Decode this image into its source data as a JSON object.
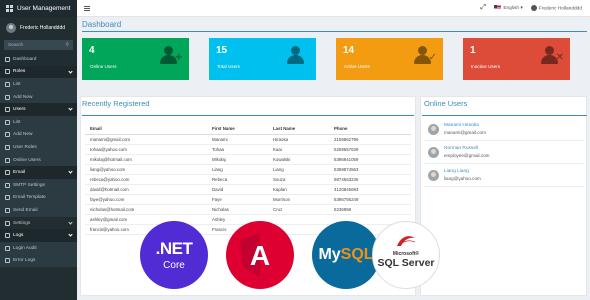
{
  "app": {
    "title": "User Management"
  },
  "sidebar": {
    "user_name": "Frederic Hollandddd",
    "search_placeholder": "Search",
    "items": [
      {
        "label": "Dashboard",
        "type": "item"
      },
      {
        "label": "Roles",
        "type": "header"
      },
      {
        "label": "List",
        "type": "sub"
      },
      {
        "label": "Add New",
        "type": "sub"
      },
      {
        "label": "Users",
        "type": "header"
      },
      {
        "label": "List",
        "type": "sub"
      },
      {
        "label": "Add New",
        "type": "sub"
      },
      {
        "label": "User Roles",
        "type": "sub"
      },
      {
        "label": "Online Users",
        "type": "sub"
      },
      {
        "label": "Email",
        "type": "header"
      },
      {
        "label": "SMTP Settings",
        "type": "sub"
      },
      {
        "label": "Email Template",
        "type": "sub"
      },
      {
        "label": "Send Email",
        "type": "sub"
      },
      {
        "label": "Settings",
        "type": "item"
      },
      {
        "label": "Logs",
        "type": "header"
      },
      {
        "label": "Login Audit",
        "type": "sub"
      },
      {
        "label": "Error Logs",
        "type": "sub"
      }
    ]
  },
  "topbar": {
    "language": "English",
    "user_name": "Frederic Hollandddd"
  },
  "page": {
    "title": "Dashboard"
  },
  "stats": [
    {
      "value": "4",
      "label": "Online Users",
      "color": "#00a65a",
      "icon": "user-plus-icon"
    },
    {
      "value": "15",
      "label": "Total Users",
      "color": "#00c0ef",
      "icon": "users-icon"
    },
    {
      "value": "14",
      "label": "Active Users",
      "color": "#f39c12",
      "icon": "user-check-icon"
    },
    {
      "value": "1",
      "label": "Inactive Users",
      "color": "#dd4b39",
      "icon": "user-times-icon"
    }
  ],
  "recent": {
    "title": "Recently Registered",
    "columns": [
      "Email",
      "First Name",
      "Last Name",
      "Phone"
    ],
    "rows": [
      [
        "manami@gmail.com",
        "Manami",
        "Hiraoka",
        "2159862796"
      ],
      [
        "tohaa@yahoo.com",
        "Tohaa",
        "Kaai",
        "5259657639"
      ],
      [
        "mikolaj@hotmail.com",
        "Mikołaj",
        "Kowalski",
        "6396941059"
      ],
      [
        "liang@yahoo.com",
        "Liang",
        "Liang",
        "5369874563"
      ],
      [
        "rebeca@yahoo.com",
        "Rebeca",
        "Souza",
        "9874563236"
      ],
      [
        "david@hotmail.com",
        "David",
        "Kaplan",
        "4120845693"
      ],
      [
        "faye@yahoo.com",
        "Faye",
        "Morrison",
        "6396756249"
      ],
      [
        "nicholas@hotmail.com",
        "Nicholas",
        "Cruz",
        "5236958"
      ],
      [
        "ashley@gmail.com",
        "Ashley",
        "",
        ""
      ],
      [
        "francis@yahoo.com",
        "Francis",
        "",
        ""
      ]
    ]
  },
  "online": {
    "title": "Online Users",
    "users": [
      {
        "name": "Manami Hiraoka",
        "email": "manami@gmail.com"
      },
      {
        "name": "Norman Russell",
        "email": "employee@gmail.com"
      },
      {
        "name": "Liang Liang",
        "email": "liang@yahoo.com"
      }
    ]
  },
  "tech_badges": {
    "net_line1": ".NET",
    "net_line2": "Core",
    "angular_letter": "A",
    "mysql_a": "My",
    "mysql_b": "SQL",
    "sql_line1": "Microsoft®",
    "sql_line2": "SQL Server"
  }
}
